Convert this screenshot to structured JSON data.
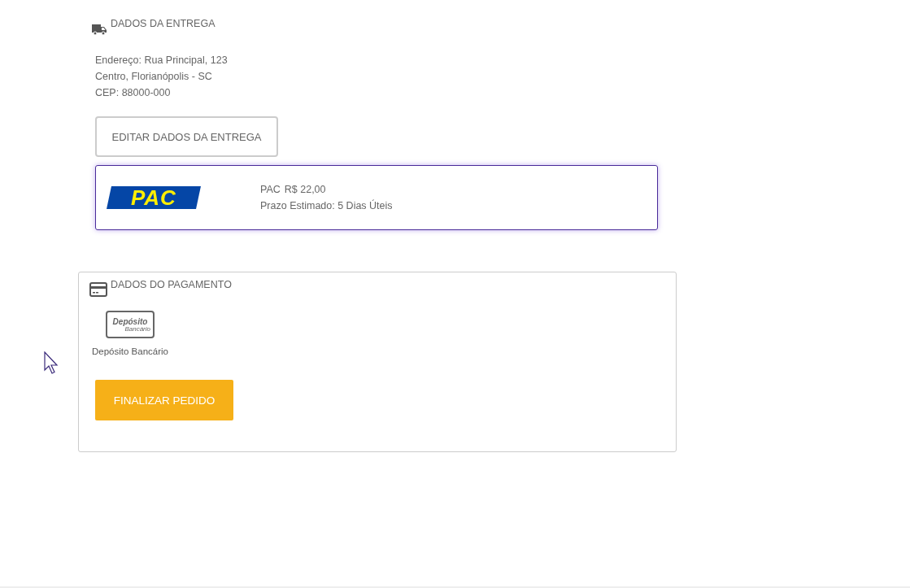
{
  "delivery": {
    "title": "DADOS DA ENTREGA",
    "address_lines": [
      "Endereço: Rua Principal, 123",
      "Centro, Florianópolis - SC",
      "CEP: 88000-000"
    ],
    "edit_button": "EDITAR DADOS DA ENTREGA",
    "shipping_options": [
      {
        "logo_text": "PAC",
        "name": "PAC",
        "price": "R$ 22,00",
        "estimate": "Prazo Estimado: 5 Dias Úteis",
        "selected": true
      }
    ]
  },
  "payment": {
    "title": "DADOS DO PAGAMENTO",
    "methods": [
      {
        "logo_text": "Depósito",
        "logo_subtext": "Bancário",
        "label": "Depósito Bancário",
        "selected": false
      }
    ],
    "finish_button": "FINALIZAR PEDIDO"
  }
}
